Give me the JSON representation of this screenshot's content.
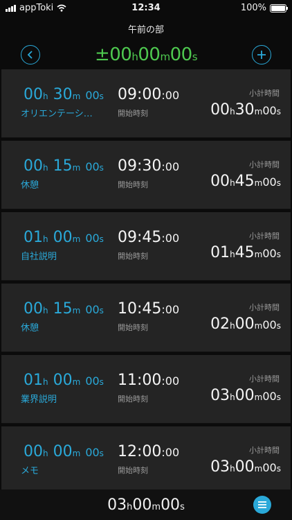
{
  "status_bar": {
    "carrier": "appToki",
    "time": "12:34",
    "battery": "100%"
  },
  "section": {
    "title": "午前の部"
  },
  "header": {
    "total_diff": {
      "sign": "±",
      "h": "00",
      "h_unit": "h",
      "m": "00",
      "m_unit": "m",
      "s": "00",
      "s_unit": "s"
    }
  },
  "labels": {
    "start": "開始時刻",
    "subtotal": "小計時間"
  },
  "items": [
    {
      "dur_h": "00",
      "dur_m": "30",
      "dur_s": "00",
      "name": "オリエンテーシ…",
      "start_hm": "09:00",
      "start_s": ":00",
      "sub_h": "00",
      "sub_m": "30",
      "sub_s": "00"
    },
    {
      "dur_h": "00",
      "dur_m": "15",
      "dur_s": "00",
      "name": "休憩",
      "start_hm": "09:30",
      "start_s": ":00",
      "sub_h": "00",
      "sub_m": "45",
      "sub_s": "00"
    },
    {
      "dur_h": "01",
      "dur_m": "00",
      "dur_s": "00",
      "name": "自社説明",
      "start_hm": "09:45",
      "start_s": ":00",
      "sub_h": "01",
      "sub_m": "45",
      "sub_s": "00"
    },
    {
      "dur_h": "00",
      "dur_m": "15",
      "dur_s": "00",
      "name": "休憩",
      "start_hm": "10:45",
      "start_s": ":00",
      "sub_h": "02",
      "sub_m": "00",
      "sub_s": "00"
    },
    {
      "dur_h": "01",
      "dur_m": "00",
      "dur_s": "00",
      "name": "業界説明",
      "start_hm": "11:00",
      "start_s": ":00",
      "sub_h": "03",
      "sub_m": "00",
      "sub_s": "00"
    },
    {
      "dur_h": "00",
      "dur_m": "00",
      "dur_s": "00",
      "name": "メモ",
      "start_hm": "12:00",
      "start_s": ":00",
      "sub_h": "03",
      "sub_m": "00",
      "sub_s": "00"
    }
  ],
  "units": {
    "h": "h",
    "m": "m",
    "s": "s"
  },
  "footer": {
    "total_h": "03",
    "total_m": "00",
    "total_s": "00"
  },
  "colors": {
    "accent": "#2aa9d9",
    "diff": "#4ec84f",
    "card": "#242424",
    "background": "#0b0b0b"
  },
  "icons": {
    "back": "chevron-left-icon",
    "add": "plus-icon",
    "menu": "list-icon"
  }
}
